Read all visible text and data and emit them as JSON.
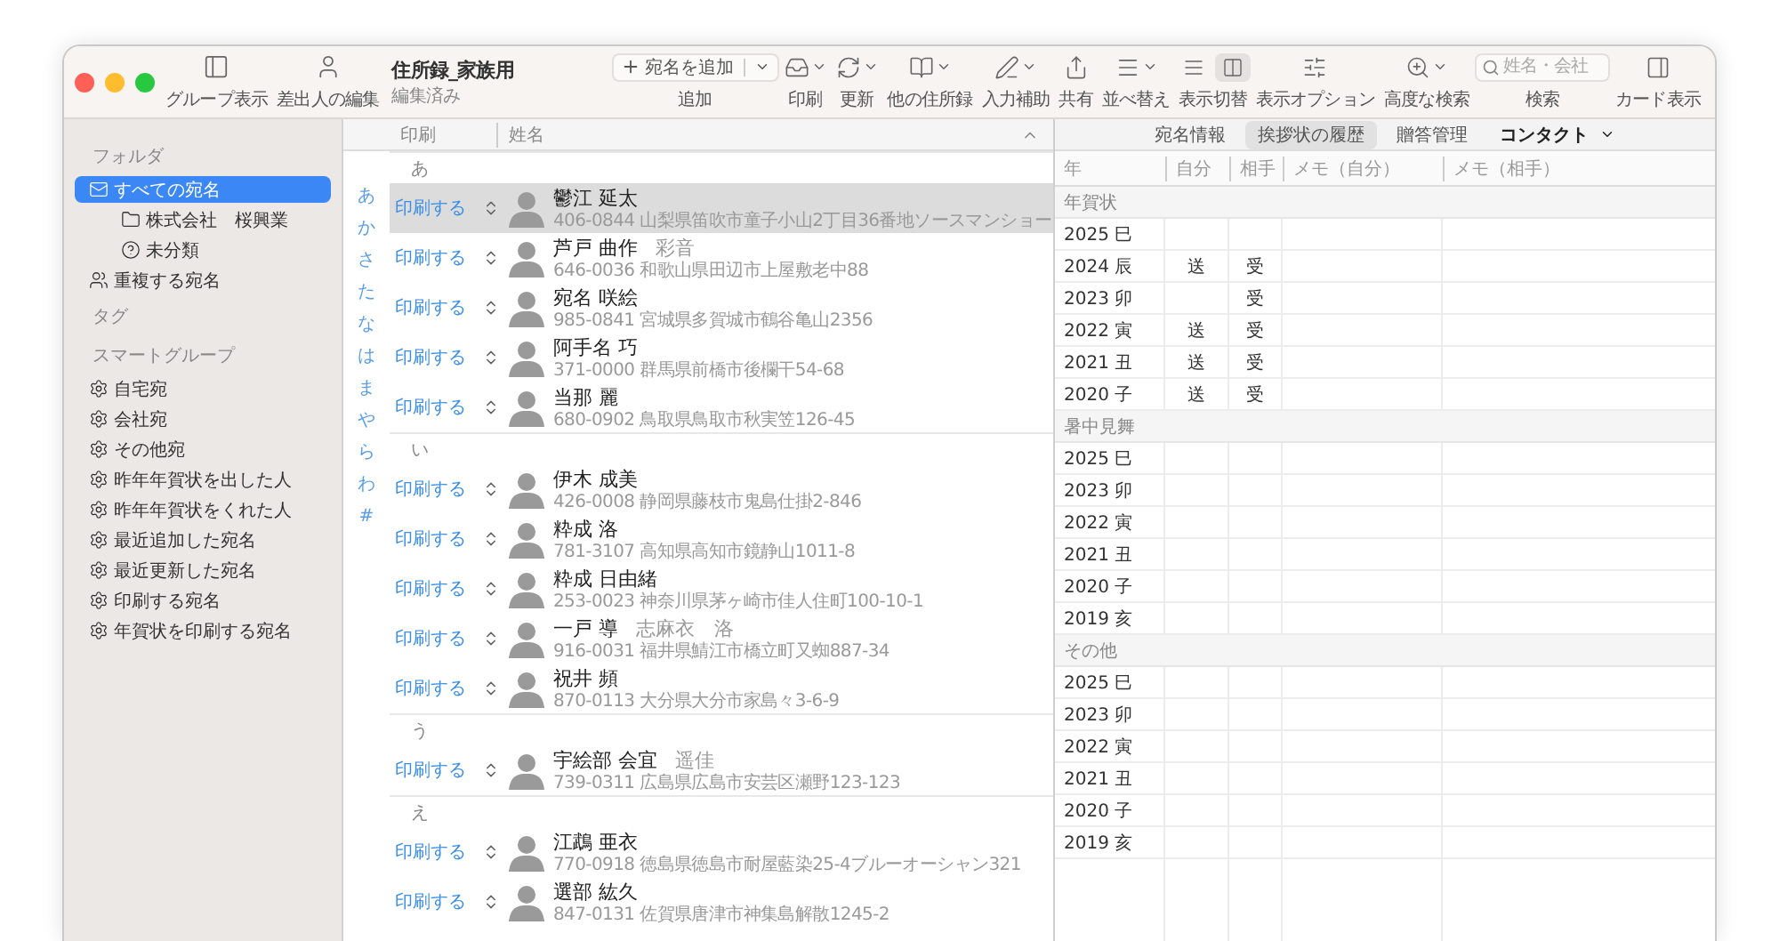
{
  "toolbar": {
    "left": [
      {
        "label": "グループ表示"
      },
      {
        "label": "差出人の編集"
      }
    ],
    "document": {
      "title": "住所録_家族用",
      "subtitle": "編集済み"
    },
    "tools": [
      {
        "kind": "add",
        "label": "追加",
        "button": "宛名を追加"
      },
      {
        "kind": "menu",
        "label": "印刷"
      },
      {
        "kind": "menu",
        "label": "更新"
      },
      {
        "kind": "menu",
        "label": "他の住所録"
      },
      {
        "kind": "menu",
        "label": "入力補助"
      },
      {
        "kind": "button",
        "label": "共有"
      },
      {
        "kind": "menu",
        "label": "並べ替え"
      },
      {
        "kind": "toggle",
        "label": "表示切替",
        "options": [
          {
            "selected": false
          },
          {
            "selected": true
          }
        ]
      },
      {
        "kind": "button",
        "label": "表示オプション"
      },
      {
        "kind": "menu",
        "label": "高度な検索"
      },
      {
        "kind": "search",
        "label": "検索",
        "placeholder": "姓名・会社"
      },
      {
        "kind": "button",
        "label": "カード表示"
      }
    ]
  },
  "sidebar": {
    "sections": [
      {
        "title": "フォルダ",
        "items": [
          {
            "kind": "all",
            "label": "すべての宛名",
            "selected": true,
            "children": [
              {
                "kind": "folder",
                "label": "株式会社　桜興業",
                "selected": false
              },
              {
                "kind": "unfiled",
                "label": "未分類",
                "selected": false
              }
            ]
          },
          {
            "kind": "duplicates",
            "label": "重複する宛名",
            "selected": false
          }
        ]
      },
      {
        "title": "タグ"
      },
      {
        "title": "スマートグループ",
        "items": [
          {
            "kind": "smart",
            "label": "自宅宛",
            "selected": false
          },
          {
            "kind": "smart",
            "label": "会社宛",
            "selected": false
          },
          {
            "kind": "smart",
            "label": "その他宛",
            "selected": false
          },
          {
            "kind": "smart",
            "label": "昨年年賀状を出した人",
            "selected": false
          },
          {
            "kind": "smart",
            "label": "昨年年賀状をくれた人",
            "selected": false
          },
          {
            "kind": "smart",
            "label": "最近追加した宛名",
            "selected": false
          },
          {
            "kind": "smart",
            "label": "最近更新した宛名",
            "selected": false
          },
          {
            "kind": "smart",
            "label": "印刷する宛名",
            "selected": false
          },
          {
            "kind": "smart",
            "label": "年賀状を印刷する宛名",
            "selected": false
          }
        ]
      }
    ]
  },
  "index": [
    "あ",
    "か",
    "さ",
    "た",
    "な",
    "は",
    "ま",
    "や",
    "ら",
    "わ",
    "#"
  ],
  "list": {
    "columns": [
      "印刷",
      "姓名"
    ],
    "groups": [
      {
        "title": "あ",
        "rows": [
          {
            "print": "印刷する",
            "name": "鬱江 延太",
            "address": "406-0844 山梨県笛吹市童子小山2丁目36番地ソースマンショー",
            "selected": true
          },
          {
            "print": "印刷する",
            "name": "芦戸 曲作",
            "extra": "彩音",
            "address": "646-0036 和歌山県田辺市上屋敷老中88",
            "selected": false
          },
          {
            "print": "印刷する",
            "name": "宛名 咲絵",
            "address": "985-0841 宮城県多賀城市鶴谷亀山2356",
            "selected": false
          },
          {
            "print": "印刷する",
            "name": "阿手名 巧",
            "address": "371-0000 群馬県前橋市後欄干54-68",
            "selected": false
          },
          {
            "print": "印刷する",
            "name": "当那 麗",
            "address": "680-0902 鳥取県鳥取市秋実笠126-45",
            "selected": false
          }
        ]
      },
      {
        "title": "い",
        "rows": [
          {
            "print": "印刷する",
            "name": "伊木 成美",
            "address": "426-0008 静岡県藤枝市鬼島仕掛2-846",
            "selected": false
          },
          {
            "print": "印刷する",
            "name": "粋成 洛",
            "address": "781-3107 高知県高知市鏡静山1011-8",
            "selected": false
          },
          {
            "print": "印刷する",
            "name": "粋成 日由緒",
            "address": "253-0023 神奈川県茅ヶ崎市佳人住町100-10-1",
            "selected": false
          },
          {
            "print": "印刷する",
            "name": "一戸 導",
            "extra": "志麻衣　洛",
            "address": "916-0031 福井県鯖江市橋立町又蜘887-34",
            "selected": false
          },
          {
            "print": "印刷する",
            "name": "祝井 頻",
            "address": "870-0113 大分県大分市家島々3-6-9",
            "selected": false
          }
        ]
      },
      {
        "title": "う",
        "rows": [
          {
            "print": "印刷する",
            "name": "宇絵部 会宜",
            "extra": "遥佳",
            "address": "739-0311 広島県広島市安芸区瀬野123-123",
            "selected": false
          }
        ]
      },
      {
        "title": "え",
        "rows": [
          {
            "print": "印刷する",
            "name": "江鵡 亜衣",
            "address": "770-0918 徳島県徳島市耐屋藍染25-4ブルーオーシャン321",
            "selected": false
          },
          {
            "print": "印刷する",
            "name": "選部 紘久",
            "address": "847-0131 佐賀県唐津市神集島解散1245-2",
            "selected": false
          }
        ]
      }
    ]
  },
  "detail": {
    "tabs": [
      {
        "kind": "tab",
        "label": "宛名情報",
        "selected": false
      },
      {
        "kind": "tab",
        "label": "挨拶状の履歴",
        "selected": true
      },
      {
        "kind": "tab",
        "label": "贈答管理",
        "selected": false
      },
      {
        "kind": "menu",
        "label": "コンタクト",
        "selected": false
      }
    ],
    "columns": [
      "年",
      "自分",
      "相手",
      "メモ（自分）",
      "メモ（相手）"
    ],
    "sections": [
      {
        "title": "年賀状",
        "rows": [
          {
            "year": "2025 巳"
          },
          {
            "year": "2024 辰",
            "sent": "送",
            "received": "受"
          },
          {
            "year": "2023 卯",
            "received": "受"
          },
          {
            "year": "2022 寅",
            "sent": "送",
            "received": "受"
          },
          {
            "year": "2021 丑",
            "sent": "送",
            "received": "受"
          },
          {
            "year": "2020 子",
            "sent": "送",
            "received": "受"
          }
        ]
      },
      {
        "title": "暑中見舞",
        "rows": [
          {
            "year": "2025 巳"
          },
          {
            "year": "2023 卯"
          },
          {
            "year": "2022 寅"
          },
          {
            "year": "2021 丑"
          },
          {
            "year": "2020 子"
          },
          {
            "year": "2019 亥"
          }
        ]
      },
      {
        "title": "その他",
        "rows": [
          {
            "year": "2025 巳"
          },
          {
            "year": "2023 卯"
          },
          {
            "year": "2022 寅"
          },
          {
            "year": "2021 丑"
          },
          {
            "year": "2020 子"
          },
          {
            "year": "2019 亥"
          }
        ]
      }
    ]
  }
}
